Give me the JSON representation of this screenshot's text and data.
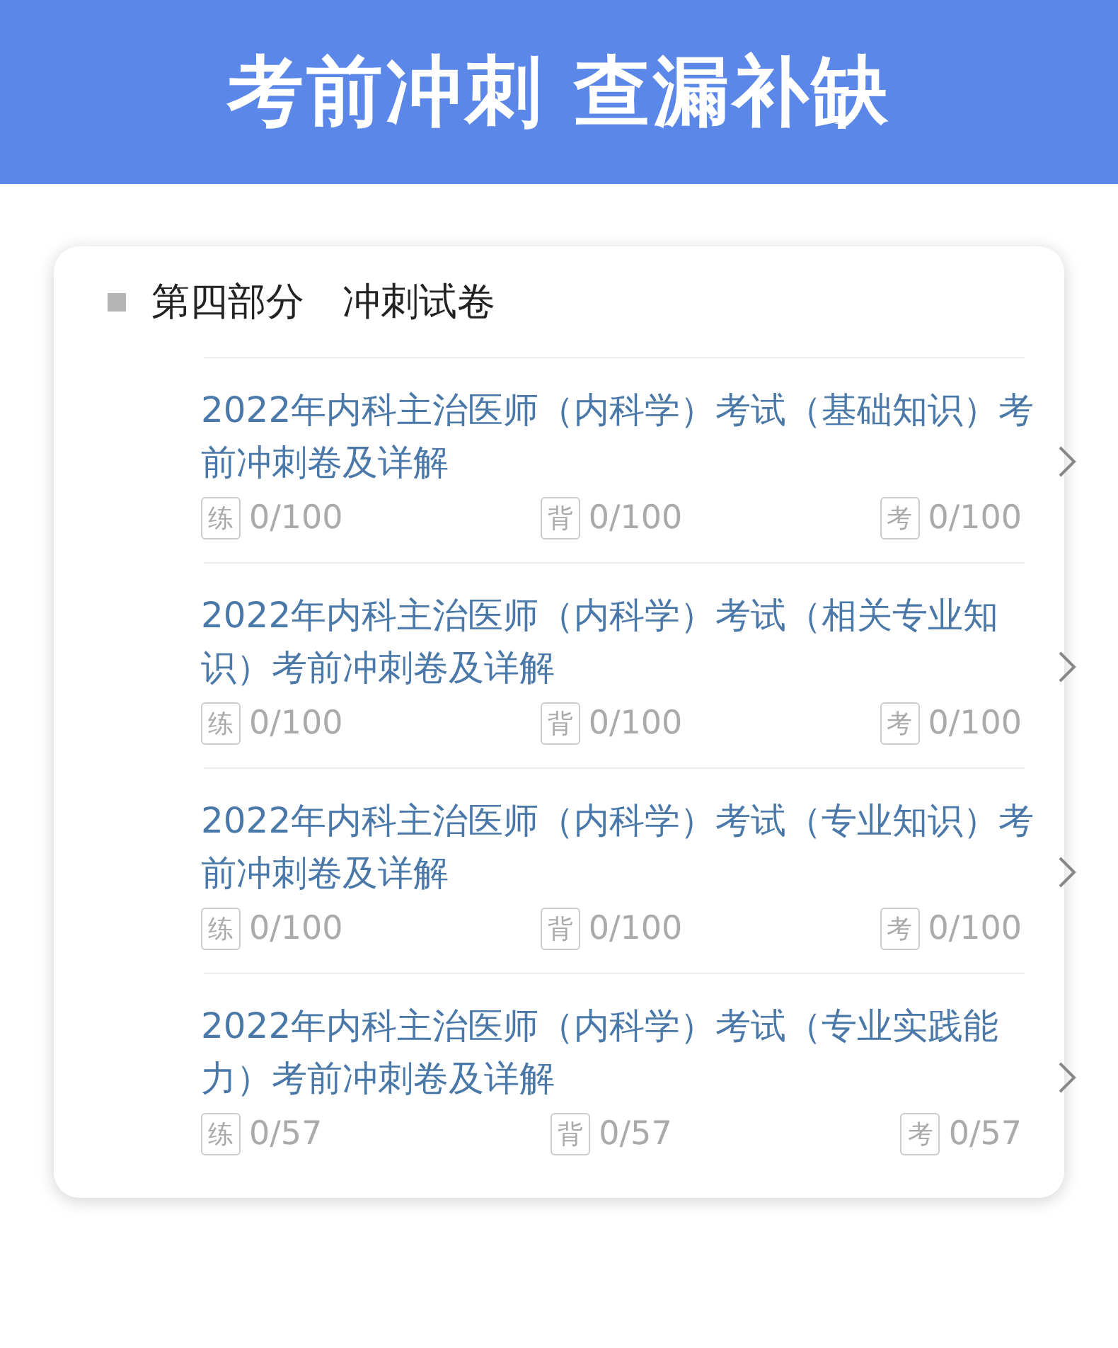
{
  "banner": {
    "title": "考前冲刺 查漏补缺"
  },
  "section": {
    "title": "第四部分　冲刺试卷",
    "items": [
      {
        "title": "2022年内科主治医师（内科学）考试（基础知识）考前冲刺卷及详解",
        "stats": [
          {
            "badge": "练",
            "count": "0/100"
          },
          {
            "badge": "背",
            "count": "0/100"
          },
          {
            "badge": "考",
            "count": "0/100"
          }
        ]
      },
      {
        "title": "2022年内科主治医师（内科学）考试（相关专业知识）考前冲刺卷及详解",
        "stats": [
          {
            "badge": "练",
            "count": "0/100"
          },
          {
            "badge": "背",
            "count": "0/100"
          },
          {
            "badge": "考",
            "count": "0/100"
          }
        ]
      },
      {
        "title": "2022年内科主治医师（内科学）考试（专业知识）考前冲刺卷及详解",
        "stats": [
          {
            "badge": "练",
            "count": "0/100"
          },
          {
            "badge": "背",
            "count": "0/100"
          },
          {
            "badge": "考",
            "count": "0/100"
          }
        ]
      },
      {
        "title": "2022年内科主治医师（内科学）考试（专业实践能力）考前冲刺卷及详解",
        "stats": [
          {
            "badge": "练",
            "count": "0/57"
          },
          {
            "badge": "背",
            "count": "0/57"
          },
          {
            "badge": "考",
            "count": "0/57"
          }
        ]
      }
    ]
  }
}
